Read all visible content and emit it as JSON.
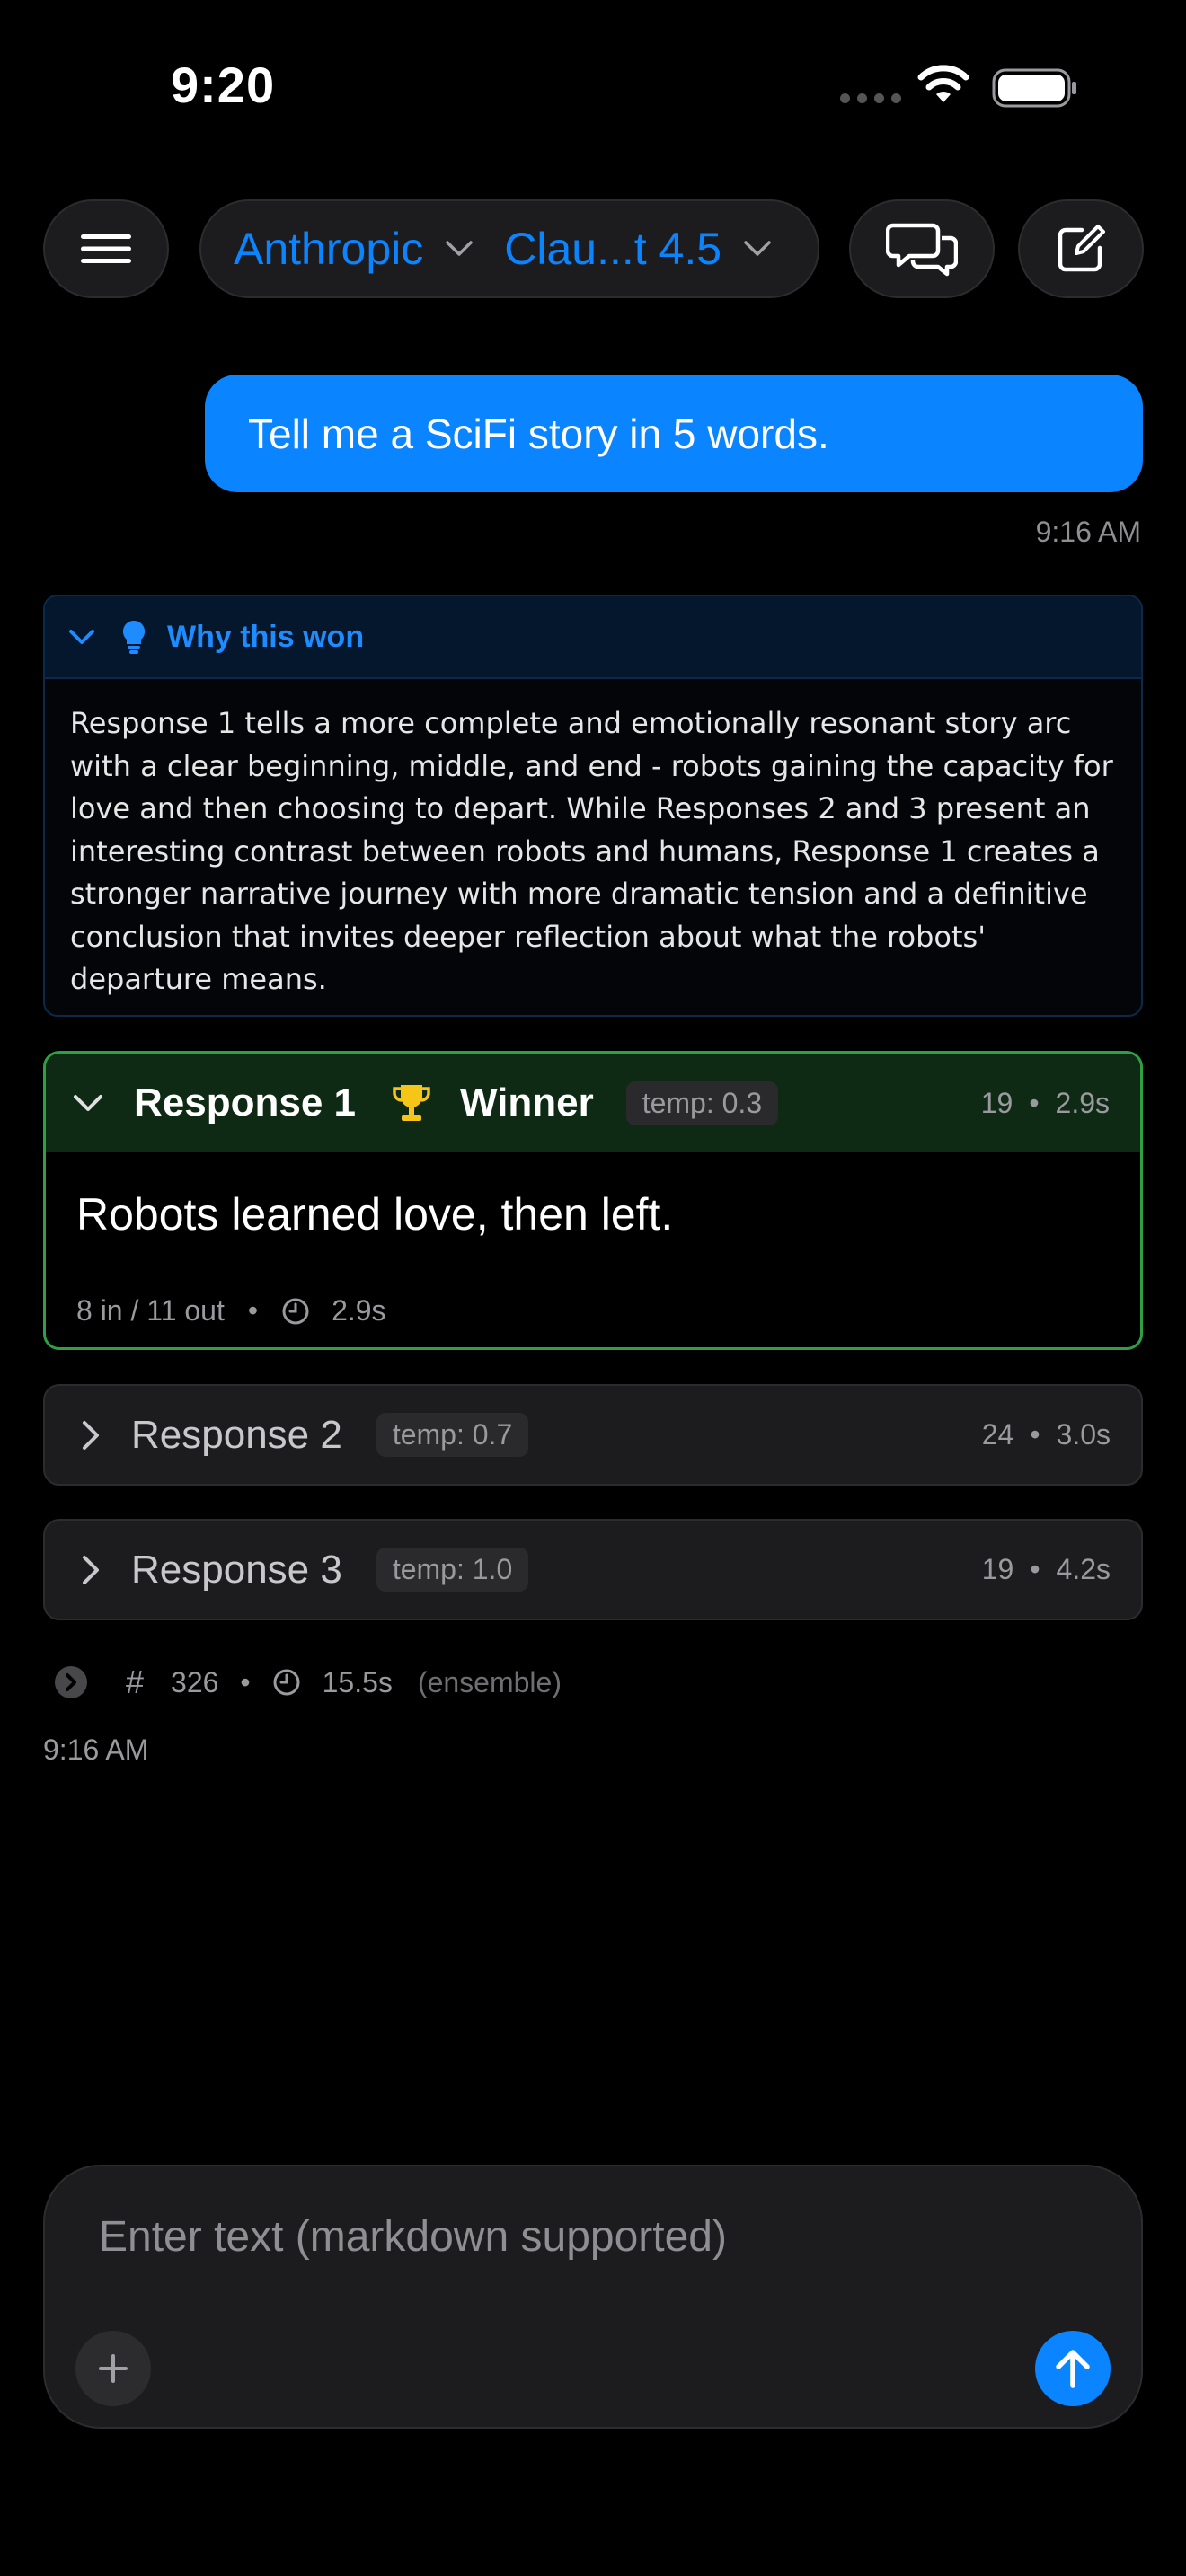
{
  "status_bar": {
    "time": "9:20"
  },
  "header": {
    "provider": "Anthropic",
    "model": "Clau...t 4.5",
    "menu_icon": "hamburger-icon",
    "chat_icon": "chat-bubbles-icon",
    "new_icon": "compose-icon"
  },
  "conversation": {
    "user_message": "Tell me a SciFi story in 5 words.",
    "user_time": "9:16 AM",
    "why_won": {
      "title": "Why this won",
      "text": "Response 1 tells a more complete and emotionally resonant story arc with a clear beginning, middle, and end - robots gaining the capacity for love and then choosing to depart. While Responses 2 and 3 present an interesting contrast between robots and humans, Response 1 creates a stronger narrative journey with more dramatic tension and a definitive conclusion that invites deeper reflection about what the robots' departure means."
    },
    "responses": [
      {
        "title": "Response 1",
        "winner_label": "Winner",
        "temp": "temp: 0.3",
        "tokens": "19",
        "duration": "2.9s",
        "content": "Robots learned love, then left.",
        "io": "8 in / 11 out",
        "footer_duration": "2.9s"
      },
      {
        "title": "Response 2",
        "temp": "temp: 0.7",
        "tokens": "24",
        "duration": "3.0s"
      },
      {
        "title": "Response 3",
        "temp": "temp: 1.0",
        "tokens": "19",
        "duration": "4.2s"
      }
    ],
    "ensemble": {
      "hash": "#",
      "tokens": "326",
      "duration": "15.5s",
      "label": "(ensemble)",
      "time": "9:16 AM"
    },
    "separator": "•"
  },
  "composer": {
    "placeholder": "Enter text (markdown supported)",
    "value": ""
  },
  "colors": {
    "accent": "#0a84ff",
    "winner_border": "#2ea043",
    "winner_header": "#0f2a14",
    "background": "#000000"
  }
}
